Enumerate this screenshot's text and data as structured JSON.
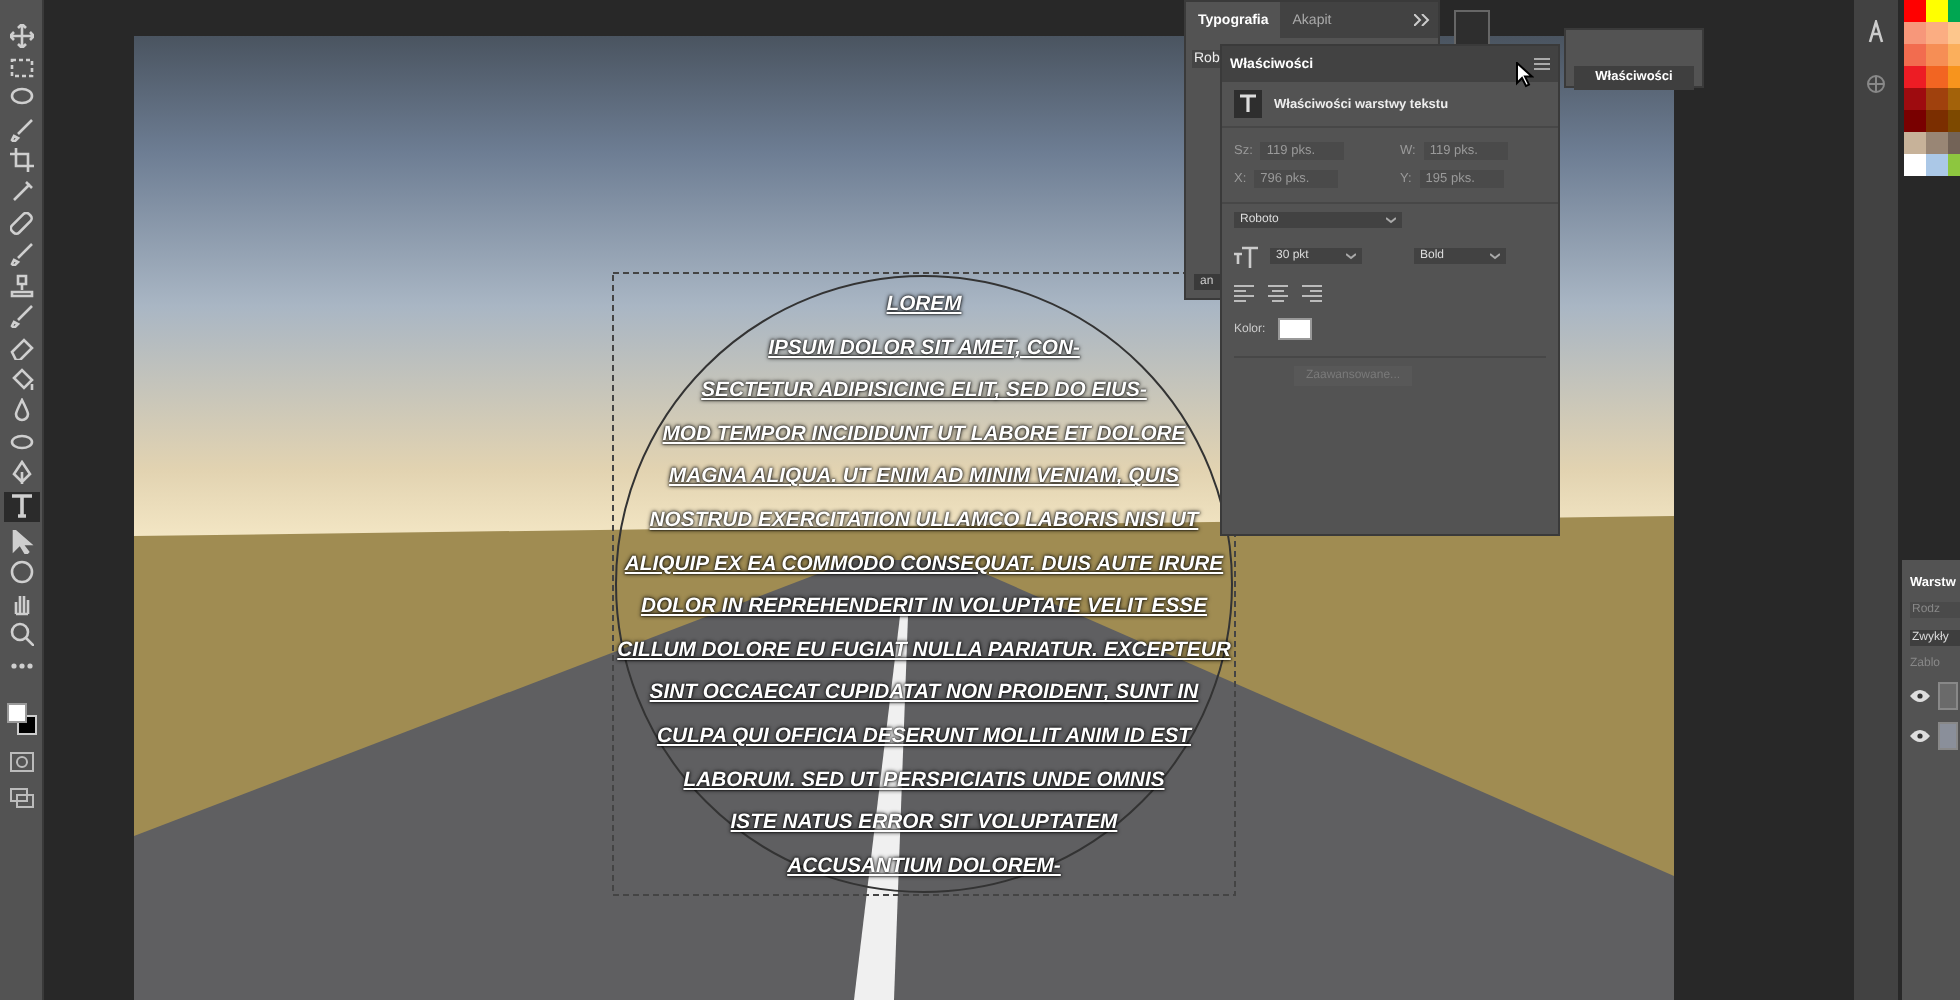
{
  "toolbar": {
    "tools": [
      {
        "kind": "move",
        "selected": false
      },
      {
        "kind": "marquee",
        "selected": false
      },
      {
        "kind": "lasso",
        "selected": false
      },
      {
        "kind": "brush",
        "selected": false
      },
      {
        "kind": "crop",
        "selected": false
      },
      {
        "kind": "eyedropper",
        "selected": false
      },
      {
        "kind": "bandage",
        "selected": false
      },
      {
        "kind": "brush",
        "selected": false
      },
      {
        "kind": "stamp",
        "selected": false
      },
      {
        "kind": "brush",
        "selected": false
      },
      {
        "kind": "eraser",
        "selected": false
      },
      {
        "kind": "bucket",
        "selected": false
      },
      {
        "kind": "blur",
        "selected": false
      },
      {
        "kind": "dodge",
        "selected": false
      },
      {
        "kind": "pen",
        "selected": false
      },
      {
        "kind": "type",
        "selected": true
      },
      {
        "kind": "pointer",
        "selected": false
      },
      {
        "kind": "ellipse",
        "selected": false
      },
      {
        "kind": "hand",
        "selected": false
      },
      {
        "kind": "zoom",
        "selected": false
      },
      {
        "kind": "more",
        "selected": false
      }
    ]
  },
  "canvas": {
    "text_lines": [
      "LOREM",
      "IPSUM DOLOR SIT AMET, CON-",
      "SECTETUR ADIPISICING ELIT, SED DO EIUS-",
      "MOD TEMPOR INCIDIDUNT UT LABORE ET DOLORE",
      "MAGNA ALIQUA. UT ENIM AD MINIM VENIAM, QUIS",
      "NOSTRUD EXERCITATION ULLAMCO LABORIS NISI UT",
      "ALIQUIP EX EA COMMODO CONSEQUAT. DUIS AUTE IRURE",
      "DOLOR IN REPREHENDERIT IN VOLUPTATE VELIT ESSE",
      "CILLUM DOLORE EU FUGIAT NULLA PARIATUR. EXCEPTEUR",
      "SINT OCCAECAT CUPIDATAT NON PROIDENT, SUNT IN",
      "CULPA QUI OFFICIA DESERUNT MOLLIT ANIM ID EST",
      "LABORUM. SED UT PERSPICIATIS UNDE OMNIS",
      "ISTE NATUS ERROR SIT VOLUPTATEM",
      "ACCUSANTIUM DOLOREM-"
    ]
  },
  "typography_panel": {
    "tabs": [
      {
        "label": "Typografia",
        "selected": true
      },
      {
        "label": "Akapit",
        "selected": false
      }
    ],
    "font_field": "Rob",
    "button": "an"
  },
  "properties_panel": {
    "title": "Właściwości",
    "section": "Właściwości warstwy tekstu",
    "transform": [
      {
        "label": "Sz:",
        "value": "119 pks."
      },
      {
        "label": "W:",
        "value": "119 pks."
      },
      {
        "label": "X:",
        "value": "796 pks."
      },
      {
        "label": "Y:",
        "value": "195 pks."
      }
    ],
    "font": "Roboto",
    "size": "30 pkt",
    "style": "Bold",
    "color_label": "Kolor:",
    "color": "#ffffff",
    "advanced_button": "Zaawansowane..."
  },
  "collapsed_panel": {
    "label": "Właściwości"
  },
  "layers_panel": {
    "title": "Warstw",
    "search_placeholder": "Rodz",
    "blend_mode": "Zwykły",
    "lock_label": "Zablo",
    "layers": [
      {
        "visible": true
      },
      {
        "visible": true
      }
    ]
  },
  "swatches": [
    {
      "color": "#ff0000"
    },
    {
      "color": "#ffff00"
    },
    {
      "color": "#00a651"
    },
    {
      "color": "#f7977a"
    },
    {
      "color": "#fbad82"
    },
    {
      "color": "#fdc68c"
    },
    {
      "color": "#f26c4f"
    },
    {
      "color": "#f68e55"
    },
    {
      "color": "#fbaf5c"
    },
    {
      "color": "#ed1c24"
    },
    {
      "color": "#f26522"
    },
    {
      "color": "#f7941d"
    },
    {
      "color": "#9e0b0f"
    },
    {
      "color": "#a0410d"
    },
    {
      "color": "#a3620a"
    },
    {
      "color": "#790000"
    },
    {
      "color": "#7b2e00"
    },
    {
      "color": "#7d4900"
    },
    {
      "color": "#c7b299"
    },
    {
      "color": "#998675"
    },
    {
      "color": "#736357"
    },
    {
      "color": "#ffffff"
    },
    {
      "color": "#abc8e7"
    },
    {
      "color": "#8dc63f"
    }
  ]
}
